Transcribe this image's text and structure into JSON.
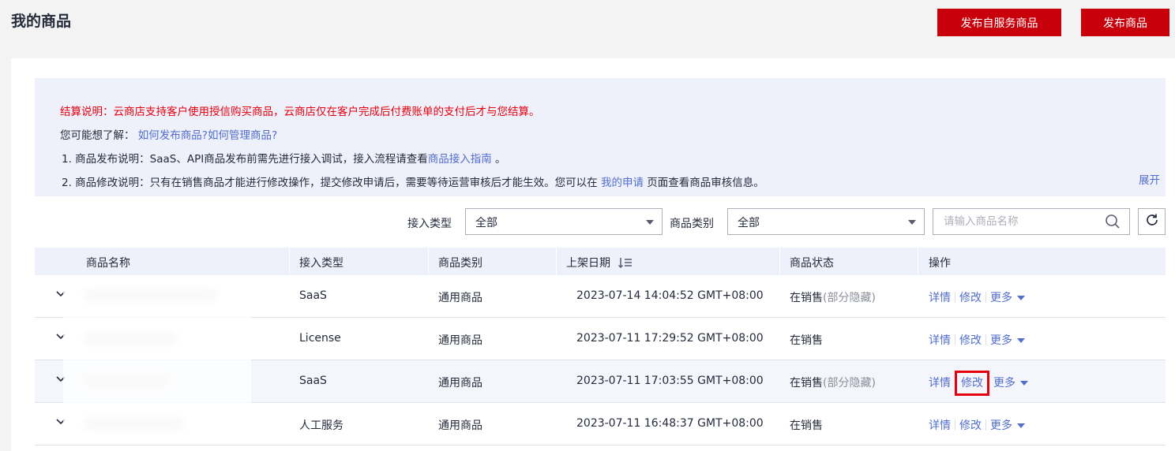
{
  "header": {
    "title": "我的商品",
    "btn_self_service": "发布自服务商品",
    "btn_publish": "发布商品"
  },
  "notice": {
    "warning": "结算说明：云商店支持客户使用授信购买商品，云商店仅在客户完成后付费账单的支付后才与您结算。",
    "maybe_prefix": "您可能想了解：",
    "maybe_link1": "如何发布商品?",
    "maybe_link2": "如何管理商品?",
    "item1_prefix": "1. 商品发布说明：SaaS、API商品发布前需先进行接入调试，接入流程请查看",
    "item1_link": "商品接入指南",
    "item1_suffix": " 。",
    "item2_prefix": "2. 商品修改说明：只有在销售商品才能进行修改操作，提交修改申请后，需要等待运营审核后才能生效。您可以在 ",
    "item2_link": "我的申请",
    "item2_suffix": " 页面查看商品审核信息。",
    "expand": "展开"
  },
  "filters": {
    "access_type_label": "接入类型",
    "access_type_value": "全部",
    "category_label": "商品类别",
    "category_value": "全部",
    "search_placeholder": "请输入商品名称"
  },
  "table": {
    "headers": [
      "商品名称",
      "接入类型",
      "商品类别",
      "上架日期",
      "商品状态",
      "操作"
    ],
    "rows": [
      {
        "access": "SaaS",
        "category": "通用商品",
        "date": "2023-07-14 14:04:52 GMT+08:00",
        "status": "在销售",
        "status_extra": "(部分隐藏)",
        "op_detail": "详情",
        "op_edit": "修改",
        "op_more": "更多"
      },
      {
        "access": "License",
        "category": "通用商品",
        "date": "2023-07-11 17:29:52 GMT+08:00",
        "status": "在销售",
        "status_extra": "",
        "op_detail": "详情",
        "op_edit": "修改",
        "op_more": "更多"
      },
      {
        "access": "SaaS",
        "category": "通用商品",
        "date": "2023-07-11 17:03:55 GMT+08:00",
        "status": "在销售",
        "status_extra": "(部分隐藏)",
        "op_detail": "详情",
        "op_edit": "修改",
        "op_more": "更多"
      },
      {
        "access": "人工服务",
        "category": "通用商品",
        "date": "2023-07-11 16:48:37 GMT+08:00",
        "status": "在销售",
        "status_extra": "",
        "op_detail": "详情",
        "op_edit": "修改",
        "op_more": "更多"
      }
    ]
  },
  "colors": {
    "brand_red": "#c7000b",
    "link_blue": "#526ecc",
    "warning_red": "#e6000e"
  }
}
